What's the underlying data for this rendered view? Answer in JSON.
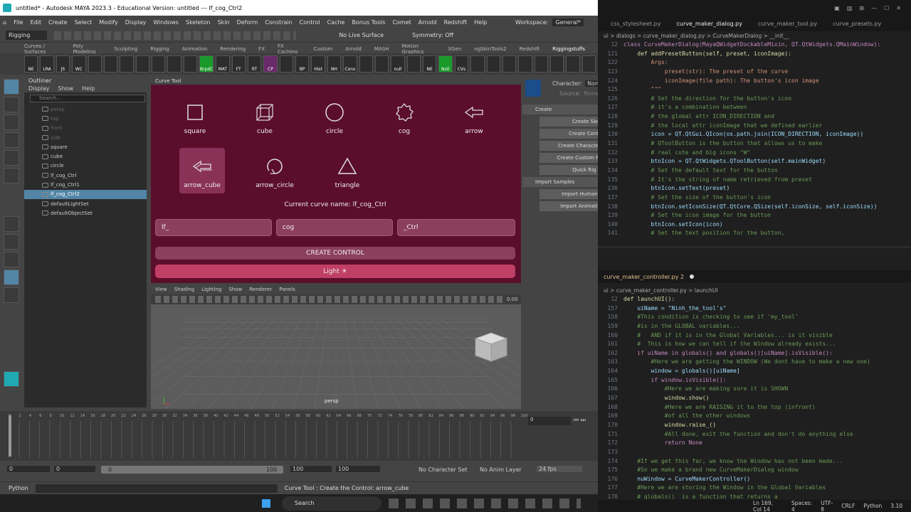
{
  "titlebar": {
    "title": "untitled* - Autodesk MAYA 2023.3 - Educational Version: untitled  ---  lf_cog_Ctrl2"
  },
  "menubar": [
    "File",
    "Edit",
    "Create",
    "Select",
    "Modify",
    "Display",
    "Windows",
    "Skeleton",
    "Skin",
    "Deform",
    "Constrain",
    "Control",
    "Cache",
    "Bonus Tools",
    "Comet",
    "Arnold",
    "Redshift",
    "Help"
  ],
  "workspace": {
    "label": "Workspace:",
    "value": "General*"
  },
  "statusline": {
    "mode": "Rigging",
    "live": "No Live Surface",
    "symmetry": "Symmetry: Off"
  },
  "shelftabs": [
    "Curves / Surfaces",
    "Poly Modeling",
    "Sculpting",
    "Rigging",
    "Animation",
    "Rendering",
    "FX",
    "FX Caching",
    "Custom",
    "Arnold",
    "MASH",
    "Motion Graphics",
    "XGen",
    "ngSkinTools2",
    "Redshift",
    "Riggingstuffs"
  ],
  "shelf": [
    "NE",
    "LRA",
    "JS",
    "WC",
    "",
    "",
    "",
    "",
    "",
    "",
    "",
    "BrpdC",
    "MAT",
    "FT",
    "RT",
    "CP",
    "",
    "BP",
    "Hist",
    "NH",
    "Cons",
    "",
    "",
    "null",
    "",
    "NE",
    "NxE",
    "CVs",
    "",
    "",
    "",
    "",
    "",
    "",
    "",
    ""
  ],
  "outliner": {
    "title": "Outliner",
    "menu": [
      "Display",
      "Show",
      "Help"
    ],
    "search_placeholder": "Search...",
    "items": [
      {
        "label": "persp",
        "dim": true
      },
      {
        "label": "top",
        "dim": true
      },
      {
        "label": "front",
        "dim": true
      },
      {
        "label": "side",
        "dim": true
      },
      {
        "label": "square",
        "dim": false
      },
      {
        "label": "cube",
        "dim": false
      },
      {
        "label": "circle",
        "dim": false
      },
      {
        "label": "lf_cog_Ctrl",
        "dim": false
      },
      {
        "label": "lf_cog_Ctrl1",
        "dim": false
      },
      {
        "label": "lf_cog_Ctrl2",
        "dim": false,
        "selected": true
      },
      {
        "label": "defaultLightSet",
        "dim": false
      },
      {
        "label": "defaultObjectSet",
        "dim": false
      }
    ]
  },
  "curvetool": {
    "title": "Curve Tool",
    "buttons": [
      "square",
      "cube",
      "circle",
      "cog",
      "arrow",
      "arrow_cube",
      "arrow_circle",
      "triangle"
    ],
    "current_name": "Current curve name: lf_cog_Ctrl",
    "prefix": "lf_",
    "name": "cog",
    "suffix": "_Ctrl",
    "create_label": "CREATE CONTROL",
    "light_label": "Light ☀"
  },
  "hik": {
    "character_label": "Character:",
    "character_value": "None",
    "source_label": "Source:",
    "source_value": "None",
    "create_section": "Create",
    "create_buttons": [
      "Create Skel",
      "Create Contr",
      "Create Character",
      "Create Custom Ri",
      "Quick Rig T"
    ],
    "import_section": "Import Samples",
    "import_buttons": [
      "Import Human I",
      "Import Animatio"
    ]
  },
  "viewport": {
    "menu": [
      "View",
      "Shading",
      "Lighting",
      "Show",
      "Renderer",
      "Panels"
    ],
    "camera": "persp",
    "value": "0.00"
  },
  "timeline": {
    "current": "0",
    "ticks": [
      "0",
      "2",
      "4",
      "6",
      "8",
      "10",
      "12",
      "14",
      "16",
      "18",
      "20",
      "22",
      "24",
      "26",
      "28",
      "30",
      "32",
      "34",
      "36",
      "38",
      "40",
      "42",
      "44",
      "46",
      "48",
      "50",
      "52",
      "54",
      "56",
      "58",
      "60",
      "62",
      "64",
      "66",
      "68",
      "70",
      "72",
      "74",
      "76",
      "78",
      "80",
      "82",
      "84",
      "86",
      "88",
      "90",
      "92",
      "94",
      "96",
      "98",
      "100"
    ]
  },
  "range": {
    "start": "0",
    "inner_start": "0",
    "slider_start": "0",
    "slider_end": "100",
    "inner_end": "100",
    "end": "100",
    "character_set": "No Character Set",
    "anim_layer": "No Anim Layer",
    "fps": "24 fps"
  },
  "cmdline": {
    "lang": "Python",
    "message": "Curve Tool : Create the Control: arrow_cube"
  },
  "taskbar": {
    "search": "Search"
  },
  "vscode": {
    "tabs": [
      {
        "label": "css_stylesheet.py",
        "active": false
      },
      {
        "label": "curve_maker_dialog.py",
        "active": true
      },
      {
        "label": "curve_maker_tool.py",
        "active": false
      },
      {
        "label": "curve_presets.py",
        "active": false
      }
    ],
    "breadcrumb1": "ui > dialogs > curve_maker_dialog.py > CurveMakerDialog > __init__",
    "lines1": [
      {
        "n": "12",
        "t": "class CurveMakerDialog(MayaQWidgetDockableMixin, QT.QtWidgets.QMainWindow):",
        "c": "kw"
      },
      {
        "n": "121",
        "t": "    def addPresetButton(self, preset, iconImage):",
        "c": "fn"
      },
      {
        "n": "122",
        "t": "        Args:",
        "c": "str"
      },
      {
        "n": "123",
        "t": "            preset(str): The preset of the curve",
        "c": "str"
      },
      {
        "n": "124",
        "t": "            iconImage(file path): The button's icon image",
        "c": "str"
      },
      {
        "n": "125",
        "t": "        \"\"\"",
        "c": "str"
      },
      {
        "n": "126",
        "t": "        # Set the direction for the button's icon",
        "c": "cmt"
      },
      {
        "n": "127",
        "t": "        # it's a combination between",
        "c": "cmt"
      },
      {
        "n": "128",
        "t": "        # the global attr ICON_DIRECTION and",
        "c": "cmt"
      },
      {
        "n": "129",
        "t": "        # the local attr iconImage that we defined earlier",
        "c": "cmt"
      },
      {
        "n": "130",
        "t": "        icon = QT.QtGui.QIcon(os.path.join(ICON_DIRECTION, iconImage))",
        "c": "var"
      },
      {
        "n": "131",
        "t": "        # QToolButton is the button that allows us to make",
        "c": "cmt"
      },
      {
        "n": "132",
        "t": "        # real cute and big icons ^W^",
        "c": "cmt"
      },
      {
        "n": "133",
        "t": "        btnIcon = QT.QtWidgets.QToolButton(self.mainWidget)",
        "c": "var"
      },
      {
        "n": "134",
        "t": "        # Set the default text for the button",
        "c": "cmt"
      },
      {
        "n": "135",
        "t": "        # It's the string of name retrieved from preset",
        "c": "cmt"
      },
      {
        "n": "136",
        "t": "        btnIcon.setText(preset)",
        "c": "var"
      },
      {
        "n": "137",
        "t": "        # Set the size of the button's icon",
        "c": "cmt"
      },
      {
        "n": "138",
        "t": "        btnIcon.setIconSize(QT.QtCore.QSize(self.iconSize, self.iconSize))",
        "c": "var"
      },
      {
        "n": "139",
        "t": "        # Set the icon image for the button",
        "c": "cmt"
      },
      {
        "n": "140",
        "t": "        btnIcon.setIcon(icon)",
        "c": "var"
      },
      {
        "n": "141",
        "t": "        # Set the text position for the button,",
        "c": "cmt"
      }
    ],
    "tab2": "curve_maker_controller.py 2",
    "breadcrumb2": "ui > curve_maker_controller.py > launchUI",
    "lines2": [
      {
        "n": "12",
        "t": "def launchUI():",
        "c": "fn"
      },
      {
        "n": "157",
        "t": "    uiName = \"Ninh_the_tool's\"",
        "c": "var"
      },
      {
        "n": "158",
        "t": "    #This condition is checking to see if 'my_tool'",
        "c": "cmt"
      },
      {
        "n": "159",
        "t": "    #is in the GLOBAL variables...",
        "c": "cmt"
      },
      {
        "n": "160",
        "t": "    #   AND if it is in the Global Variables... is it visible",
        "c": "cmt"
      },
      {
        "n": "161",
        "t": "    #  This is how we can tell if the Window already exists...",
        "c": "cmt"
      },
      {
        "n": "162",
        "t": "    if uiName in globals() and globals()[uiName].isVisible():",
        "c": "kw"
      },
      {
        "n": "163",
        "t": "        #Here we are getting the WINDOW (We dont have to make a new one)",
        "c": "cmt"
      },
      {
        "n": "164",
        "t": "        window = globals()[uiName]",
        "c": "var"
      },
      {
        "n": "165",
        "t": "        if window.isVisible():",
        "c": "kw"
      },
      {
        "n": "166",
        "t": "            #Here we are making sure it is SHOWN",
        "c": "cmt"
      },
      {
        "n": "167",
        "t": "            window.show()",
        "c": "fn"
      },
      {
        "n": "168",
        "t": "            #Here we are RAISING it to the top (infront)",
        "c": "cmt"
      },
      {
        "n": "169",
        "t": "            #of all the other windows",
        "c": "cmt"
      },
      {
        "n": "170",
        "t": "            window.raise_()",
        "c": "fn"
      },
      {
        "n": "171",
        "t": "            #All done, exit the function and don't do anything else",
        "c": "cmt"
      },
      {
        "n": "172",
        "t": "            return None",
        "c": "kw"
      },
      {
        "n": "173",
        "t": "",
        "c": "plain"
      },
      {
        "n": "174",
        "t": "    #If we get this far, we know the Window has not been made...",
        "c": "cmt"
      },
      {
        "n": "175",
        "t": "    #So we make a brand new CurveMakerDialog window",
        "c": "cmt"
      },
      {
        "n": "176",
        "t": "    nuWindow = CurveMakerController()",
        "c": "var"
      },
      {
        "n": "177",
        "t": "    #Here we are storing the Window in the Global Variables",
        "c": "cmt"
      },
      {
        "n": "178",
        "t": "    # globals()  is a function that returns a",
        "c": "cmt"
      }
    ],
    "status": [
      "Ln 169, Col 14",
      "Spaces: 4",
      "UTF-8",
      "CRLF",
      "Python",
      "3.10"
    ]
  }
}
